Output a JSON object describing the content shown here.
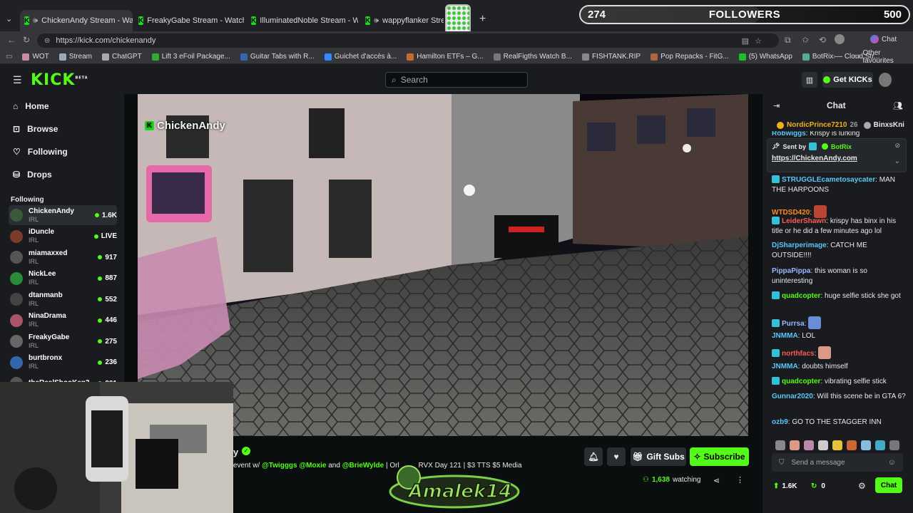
{
  "browser": {
    "tabs": [
      {
        "title": "ChickenAndy Stream - Watch"
      },
      {
        "title": "FreakyGabe Stream - Watch L"
      },
      {
        "title": "IlluminatedNoble Stream - Watch"
      },
      {
        "title": "wappyflanker Stream - W"
      }
    ],
    "url": "https://kick.com/chickenandy",
    "bookmarks": [
      "WOT",
      "Stream",
      "ChatGPT",
      "Lift 3 eFoil Package...",
      "Guitar Tabs with R...",
      "Guichet d'accès à...",
      "Hamilton ETFs – G...",
      "RealFigths Watch B...",
      "FISHTANK.RIP",
      "Pop Repacks - FitG...",
      "(5) WhatsApp",
      "BotRix — Cloud Str..."
    ],
    "other_favourites": "Other favourites",
    "copilot_label": "Chat"
  },
  "overlay": {
    "followers_current": "274",
    "followers_label": "FOLLOWERS",
    "followers_goal": "500",
    "followers_progress": 0.548,
    "logo_text": "Amalek14"
  },
  "kick": {
    "logo": "KICK",
    "logo_badge": "BETA",
    "search_placeholder": "Search",
    "get_kicks": "Get KICKs",
    "nav": [
      "Home",
      "Browse",
      "Following",
      "Drops"
    ],
    "following_title": "Following",
    "following": [
      {
        "name": "ChickenAndy",
        "cat": "IRL",
        "count": "1.6K",
        "color": "#3a5a3a"
      },
      {
        "name": "iDuncle",
        "cat": "IRL",
        "count": "LIVE",
        "color": "#7a3b2a"
      },
      {
        "name": "miamaxxed",
        "cat": "IRL",
        "count": "917",
        "color": "#555"
      },
      {
        "name": "NickLee",
        "cat": "IRL",
        "count": "887",
        "color": "#2a8a3a"
      },
      {
        "name": "dtanmanb",
        "cat": "IRL",
        "count": "552",
        "color": "#444"
      },
      {
        "name": "NinaDrama",
        "cat": "IRL",
        "count": "446",
        "color": "#a56"
      },
      {
        "name": "FreakyGabe",
        "cat": "IRL",
        "count": "275",
        "color": "#666"
      },
      {
        "name": "burtbronx",
        "cat": "IRL",
        "count": "236",
        "color": "#36a"
      },
      {
        "name": "theRealShooKen3",
        "cat": "",
        "count": "201",
        "color": "#555"
      }
    ]
  },
  "video": {
    "watermark": "ChickenAndy"
  },
  "stream": {
    "streamer_name_tail": "y",
    "title_parts": [
      "event w/ ",
      "@Twigggs",
      " ",
      "@Moxie",
      " and ",
      "@BrieWylde",
      " | Orl",
      " RVX Day 121 | $3 TTS $5 Media"
    ],
    "viewers": "1,638",
    "watching": "watching",
    "gift_subs": "Gift Subs",
    "subscribe": "Subscribe"
  },
  "chat": {
    "title": "Chat",
    "leaderboard": [
      {
        "name": "NordicPrince7210",
        "count": "26"
      },
      {
        "name": "BinxsKni",
        "count": ""
      }
    ],
    "partial_top": {
      "user": "Robwiggs",
      "text": "Krispy is lurking"
    },
    "pinned": {
      "sent_by": "Sent by",
      "sender": "BotRix",
      "link": "https://ChickenAndy.com"
    },
    "messages": [
      {
        "user": "STRUGGLEcametosaycater",
        "color": "#5ac8fa",
        "text": "MAN THE HARPOONS",
        "badge": true,
        "emote": ""
      },
      {
        "user": "WTDSD420",
        "color": "#ff8c1a",
        "text": "",
        "badge": false,
        "emote": "#b43"
      },
      {
        "user": "LeiderShawn",
        "color": "#ff5a5a",
        "text": "krispy has binx in his title or he did a few minutes ago lol",
        "badge": true,
        "emote": ""
      },
      {
        "user": "DjSharperimage",
        "color": "#5ac8fa",
        "text": "CATCH ME OUTSIDE!!!!",
        "badge": false,
        "emote": ""
      },
      {
        "user": "PippaPippa",
        "color": "#9ab8ff",
        "text": "this woman is so uninteresting",
        "badge": false,
        "emote": ""
      },
      {
        "user": "quadcopter",
        "color": "#53fc18",
        "text": "huge selfie stick she got",
        "badge": true,
        "emote": ""
      },
      {
        "user": "Purrsa",
        "color": "#9ab8ff",
        "text": "",
        "badge": true,
        "emote": "#6a8cd9"
      },
      {
        "user": "JNMMA",
        "color": "#5ac8fa",
        "text": "LOL",
        "badge": false,
        "emote": ""
      },
      {
        "user": "northfacs",
        "color": "#ff5a5a",
        "text": "",
        "badge": true,
        "emote": "#d98"
      },
      {
        "user": "JNMMA",
        "color": "#5ac8fa",
        "text": "doubts himself",
        "badge": false,
        "emote": ""
      },
      {
        "user": "quadcopter",
        "color": "#53fc18",
        "text": "vibrating selfie stick",
        "badge": true,
        "emote": ""
      },
      {
        "user": "Gunnar2020",
        "color": "#5ac8fa",
        "text": "Will this scene be in GTA 6?",
        "badge": false,
        "emote": ""
      },
      {
        "user": "ozb9",
        "color": "#5ac8fa",
        "text": "GO TO THE STAGGER INN",
        "badge": false,
        "emote": ""
      }
    ],
    "send_placeholder": "Send a message",
    "kicks_count": "1.6K",
    "zero_count": "0",
    "chat_button": "Chat"
  }
}
